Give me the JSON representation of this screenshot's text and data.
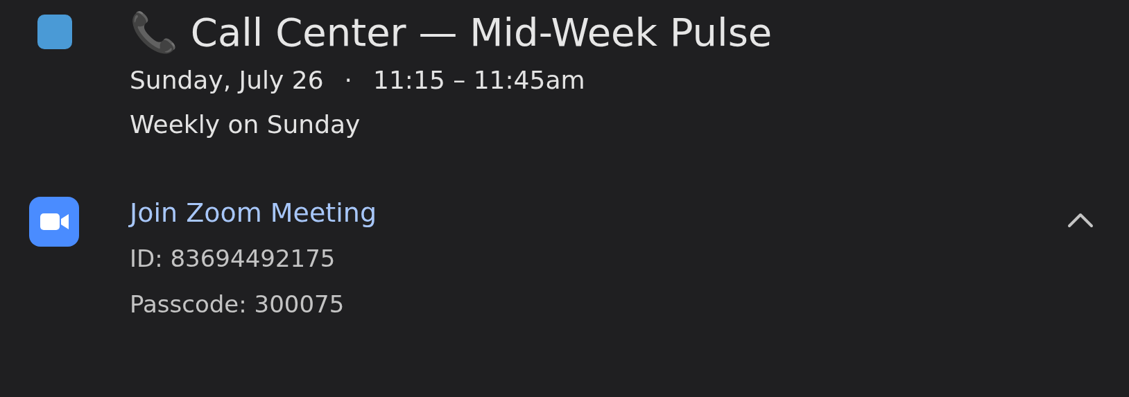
{
  "event": {
    "color": "#4a9ad6",
    "title": "📞 Call Center — Mid-Week Pulse",
    "when": "Sunday, July 26",
    "separator": "·",
    "time": "11:15 – 11:45am",
    "recurrence": "Weekly on Sunday"
  },
  "conference": {
    "link": "Join Zoom Meeting",
    "details": [
      "ID: 83694492175",
      "Passcode: 300075"
    ],
    "expanded": true
  }
}
